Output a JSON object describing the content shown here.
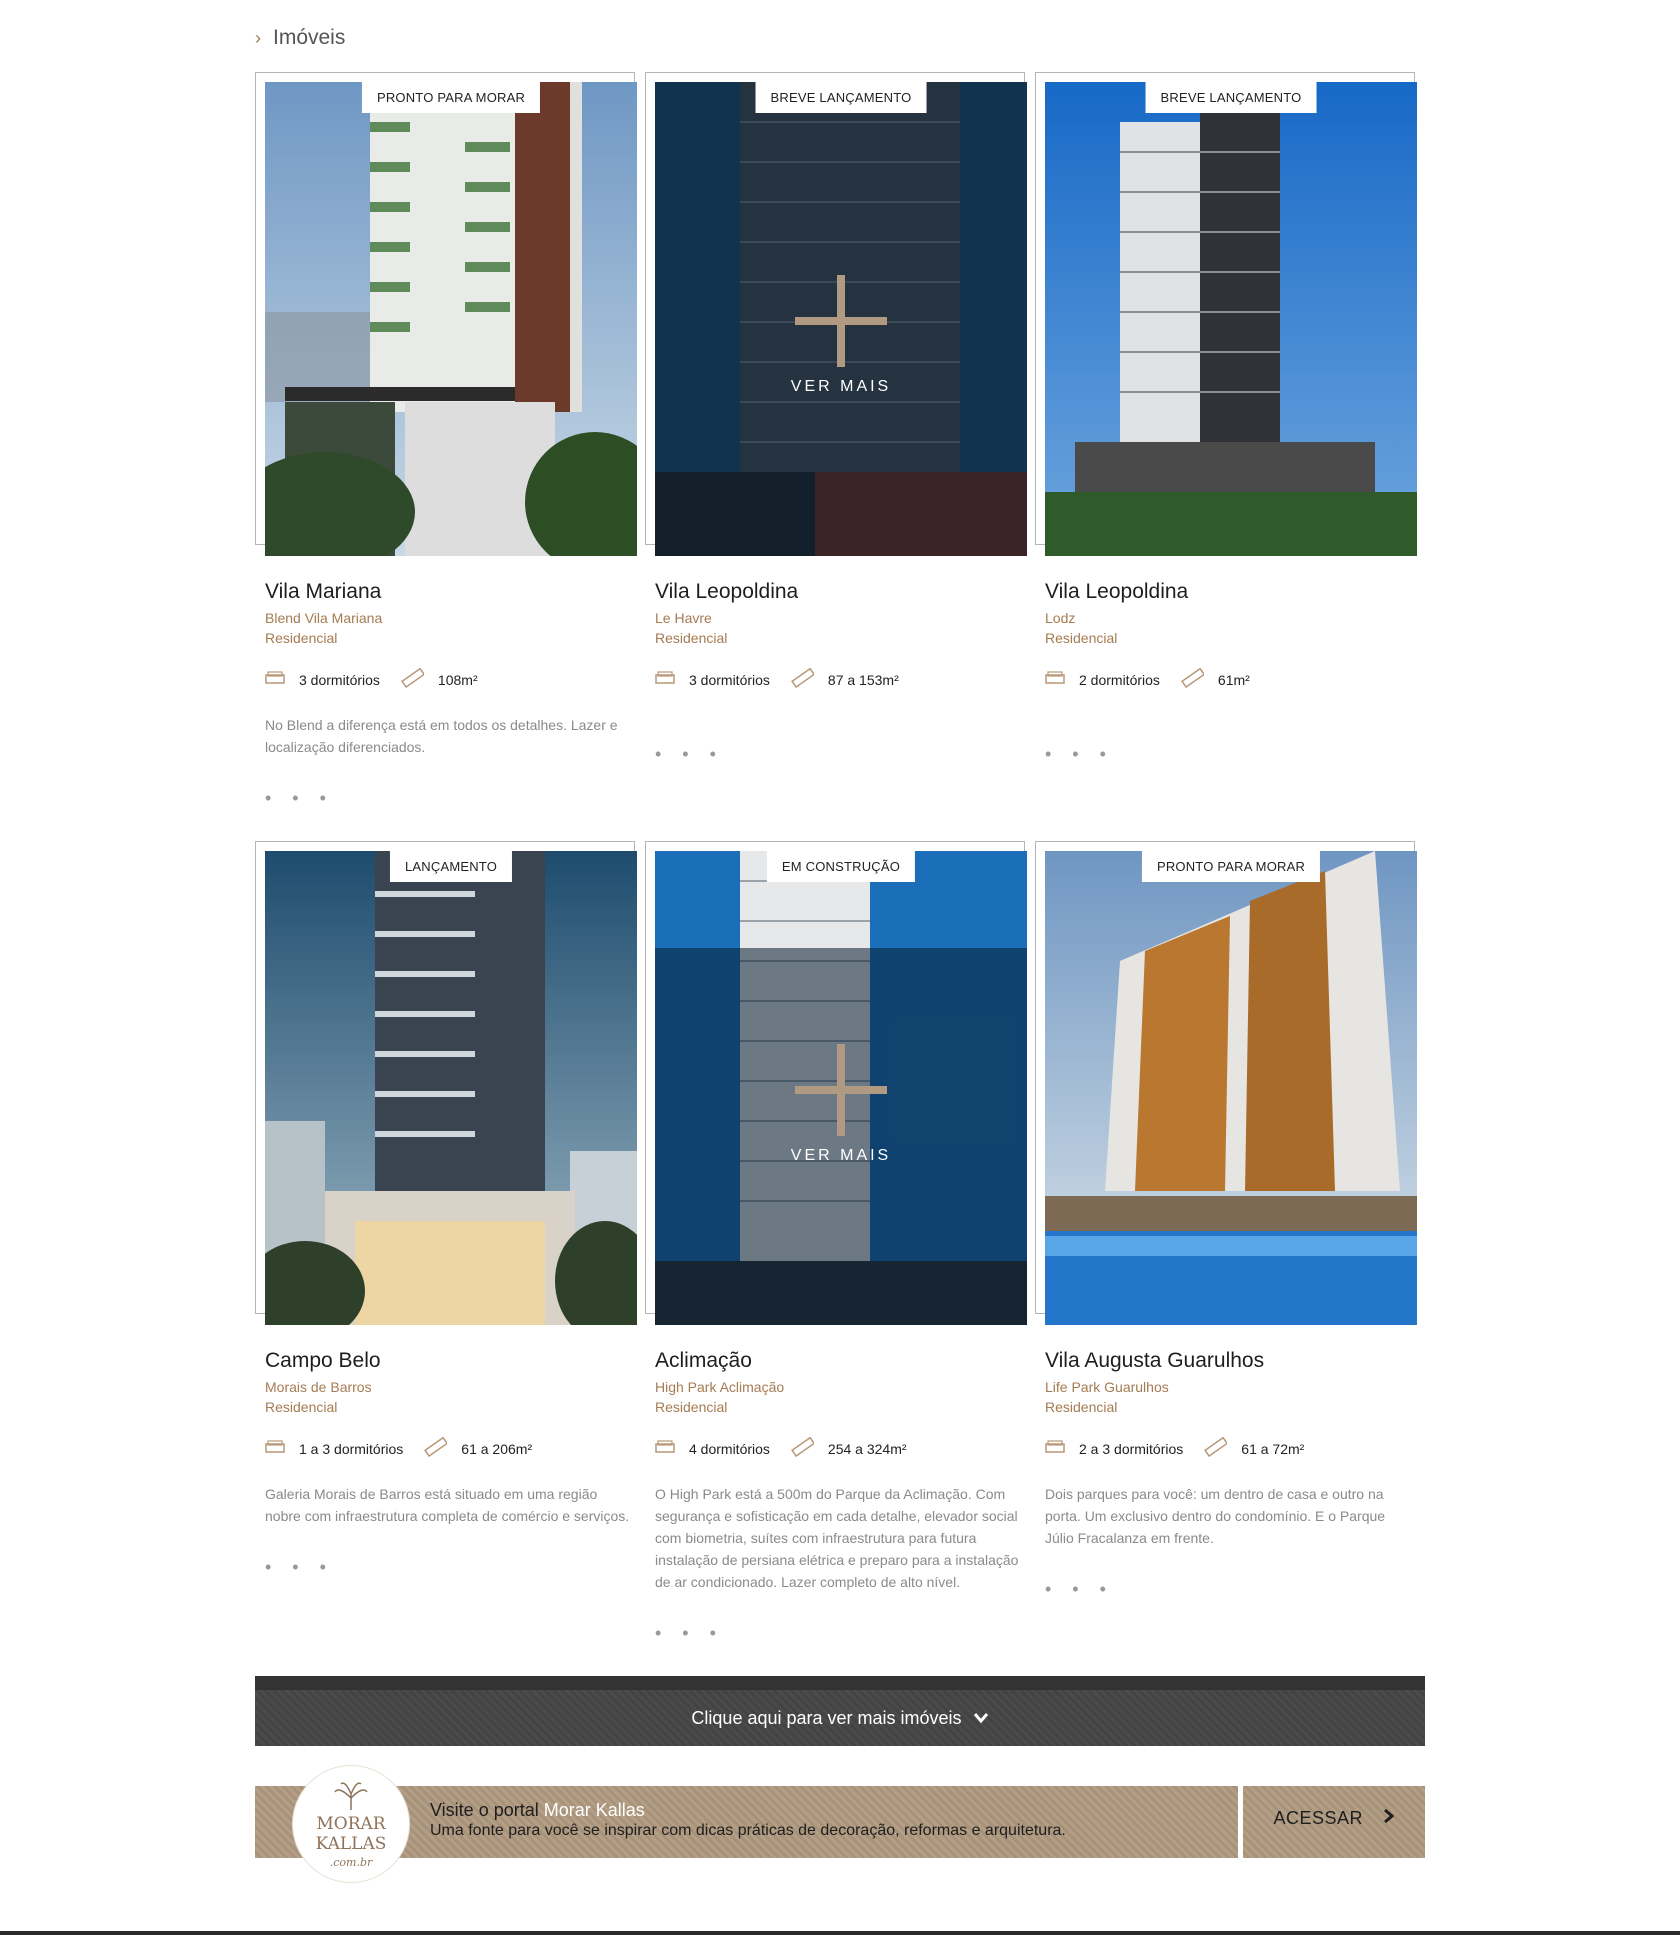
{
  "breadcrumb": {
    "label": "Imóveis"
  },
  "cards": [
    {
      "badge": "PRONTO PARA MORAR",
      "title": "Vila Mariana",
      "subtitle": "Blend Vila Mariana",
      "type": "Residencial",
      "rooms": "3 dormitórios",
      "area": "108m²",
      "desc": "No Blend a diferença está em todos os detalhes. Lazer e localização diferenciados.",
      "more": "• • •"
    },
    {
      "badge": "BREVE LANÇAMENTO",
      "title": "Vila Leopoldina",
      "subtitle": "Le Havre",
      "type": "Residencial",
      "rooms": "3 dormitórios",
      "area": "87 a 153m²",
      "desc": "",
      "more": "• • •",
      "hover": "VER MAIS"
    },
    {
      "badge": "BREVE LANÇAMENTO",
      "title": "Vila Leopoldina",
      "subtitle": "Lodz",
      "type": "Residencial",
      "rooms": "2 dormitórios",
      "area": "61m²",
      "desc": "",
      "more": "• • •"
    },
    {
      "badge": "LANÇAMENTO",
      "title": "Campo Belo",
      "subtitle": "Morais de Barros",
      "type": "Residencial",
      "rooms": "1 a 3 dormitórios",
      "area": "61 a 206m²",
      "desc": "Galeria Morais de Barros está situado em uma região nobre com infraestrutura completa de comércio e serviços.",
      "more": "• • •"
    },
    {
      "badge": "EM CONSTRUÇÃO",
      "title": "Aclimação",
      "subtitle": "High Park Aclimação",
      "type": "Residencial",
      "rooms": "4 dormitórios",
      "area": "254 a 324m²",
      "desc": "O High Park está a 500m do Parque da Aclimação. Com segurança e sofisticação em cada detalhe, elevador social com biometria, suítes com infraestrutura para futura instalação de persiana elétrica e preparo para a instalação de ar condicionado. Lazer completo de alto nível.",
      "more": "• • •",
      "hover": "VER MAIS"
    },
    {
      "badge": "PRONTO PARA MORAR",
      "title": "Vila Augusta Guarulhos",
      "subtitle": "Life Park Guarulhos",
      "type": "Residencial",
      "rooms": "2 a 3 dormitórios",
      "area": "61 a 72m²",
      "desc": "Dois parques para você: um dentro de casa e outro na porta. Um exclusivo dentro do condomínio. E o Parque Júlio Fracalanza em frente.",
      "more": "• • •"
    }
  ],
  "more_button": {
    "label": "Clique aqui para ver mais imóveis"
  },
  "portal": {
    "logo_line1": "MORAR",
    "logo_line2": "KALLAS",
    "logo_line3": ".com.br",
    "lead": "Visite o portal ",
    "brand": "Morar Kallas",
    "tagline": "Uma fonte para você se inspirar com dicas práticas de decoração, reformas e arquitetura.",
    "cta": "ACESSAR"
  }
}
